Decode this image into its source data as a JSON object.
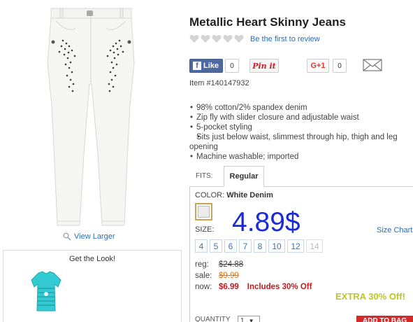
{
  "product": {
    "title": "Metallic Heart Skinny Jeans",
    "review_link": "Be the first to review",
    "rating_hearts": 5,
    "item_number": "Item #140147932",
    "view_larger": "View Larger"
  },
  "social": {
    "like_label": "Like",
    "like_count": "0",
    "pinit_label": "Pin it",
    "gplus_label": "G+1",
    "gplus_count": "0"
  },
  "features": [
    "98% cotton/2% spandex denim",
    "Zip fly with slider closure and adjustable waist",
    "5-pocket styling",
    "Sits just below waist, slimmest through hip, thigh and leg opening",
    "Machine washable; imported"
  ],
  "fits": {
    "label": "FITS:",
    "tab": "Regular"
  },
  "color": {
    "label": "COLOR:",
    "value": "White Denim",
    "swatch_hex": "#eeeceb"
  },
  "size": {
    "label": "SIZE:",
    "chart_link": "Size Chart",
    "options": [
      "4",
      "5",
      "6",
      "7",
      "8",
      "10",
      "12",
      "14"
    ],
    "disabled": [
      "14"
    ]
  },
  "overlay_price": "4.89$",
  "pricing": {
    "reg_label": "reg:",
    "reg_value": "$24.88",
    "sale_label": "sale:",
    "sale_value": "$9.99",
    "now_label": "now:",
    "now_value": "$6.99",
    "includes": "Includes 30% Off",
    "extra": "EXTRA 30% Off!"
  },
  "cart": {
    "quantity_label": "QUANTITY",
    "quantity_value": "1",
    "add_label": "ADD TO BAG"
  },
  "look": {
    "title": "Get the Look!"
  },
  "colors": {
    "link": "#2a6db5",
    "price_overlay": "#1a2bd6",
    "now_red": "#c0191f",
    "sale_orange": "#e0741b",
    "extra_green": "#b8c91d",
    "facebook": "#4e69a2"
  }
}
